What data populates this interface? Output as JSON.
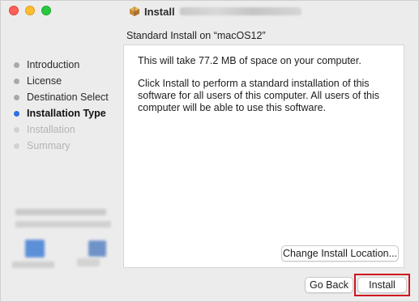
{
  "window": {
    "title": "Install",
    "title_suffix_obscured": true
  },
  "subtitle": "Standard Install on “macOS12”",
  "sidebar": {
    "steps": [
      {
        "label": "Introduction",
        "state": "done"
      },
      {
        "label": "License",
        "state": "done"
      },
      {
        "label": "Destination Select",
        "state": "done"
      },
      {
        "label": "Installation Type",
        "state": "current"
      },
      {
        "label": "Installation",
        "state": "future"
      },
      {
        "label": "Summary",
        "state": "future"
      }
    ]
  },
  "content": {
    "space_message": "This will take 77.2 MB of space on your computer.",
    "install_message": "Click Install to perform a standard installation of this software for all users of this computer. All users of this computer will be able to use this software."
  },
  "buttons": {
    "change_location": "Change Install Location...",
    "go_back": "Go Back",
    "install": "Install"
  },
  "colors": {
    "current_step_dot": "#2f6fe0",
    "highlight_outline": "#d0131f",
    "close": "#fe5f57",
    "minimize": "#febc2e",
    "maximize": "#28c840"
  }
}
